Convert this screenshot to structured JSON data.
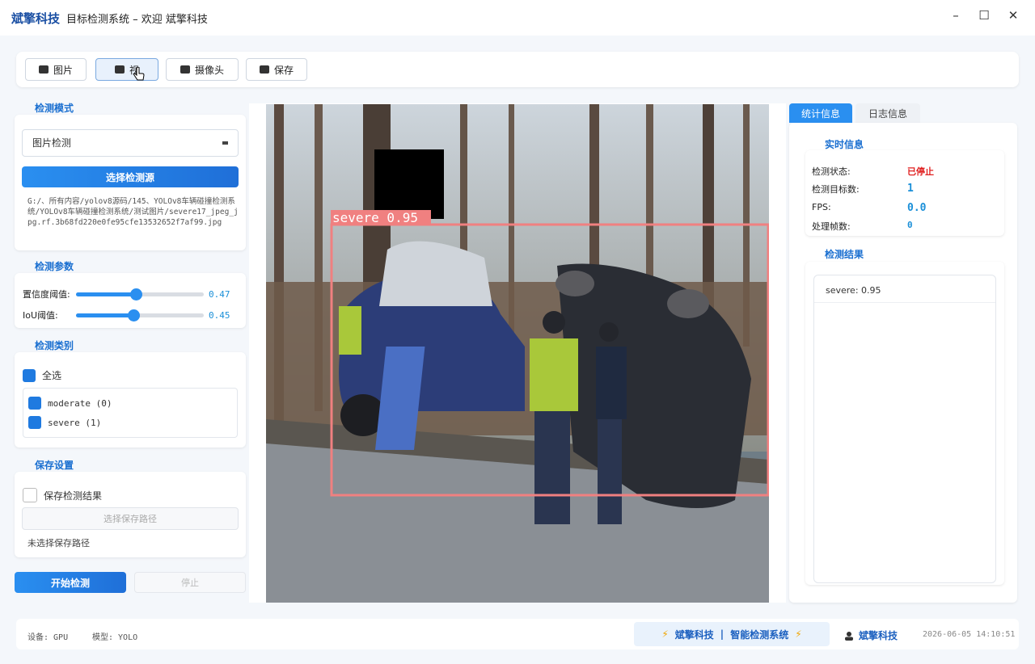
{
  "window": {
    "brand": "斌擎科技",
    "title": "目标检测系统 – 欢迎 斌擎科技",
    "minimize": "–",
    "maximize": "☐",
    "close": "✕"
  },
  "toolbar": {
    "image": "图片",
    "video": "视",
    "camera": "摄像头",
    "save": "保存"
  },
  "mode": {
    "heading": "检测模式",
    "selected": "图片检测",
    "select_source": "选择检测源",
    "path": "G:/、所有内容/yolov8源码/145、YOLOv8车辆碰撞检测系统/YOLOv8车辆碰撞检测系统/测试图片/severe17_jpeg_jpg.rf.3b68fd220e0fe95cfe13532652f7af99.jpg"
  },
  "params": {
    "heading": "检测参数",
    "conf_label": "置信度阈值:",
    "conf_value": "0.47",
    "conf": 0.47,
    "iou_label": "IoU阈值:",
    "iou_value": "0.45",
    "iou": 0.45
  },
  "classes": {
    "heading": "检测类别",
    "all": "全选",
    "items": [
      {
        "label": "moderate (0)"
      },
      {
        "label": "severe (1)"
      }
    ]
  },
  "savecfg": {
    "heading": "保存设置",
    "save_results": "保存检测结果",
    "choose_path": "选择保存路径",
    "no_path": "未选择保存路径"
  },
  "actions": {
    "start": "开始检测",
    "stop": "停止"
  },
  "detection": {
    "box_label": "severe 0.95",
    "box_color": "#f08080"
  },
  "tabs": {
    "stats": "统计信息",
    "logs": "日志信息"
  },
  "realtime": {
    "heading": "实时信息",
    "status_label": "检测状态:",
    "status_value": "已停止",
    "count_label": "检测目标数:",
    "count_value": "1",
    "fps_label": "FPS:",
    "fps_value": "0.0",
    "frames_label": "处理帧数:",
    "frames_value": "0"
  },
  "results": {
    "heading": "检测结果",
    "items": [
      "severe: 0.95"
    ]
  },
  "status": {
    "device": "设备: GPU",
    "model": "模型: YOLO",
    "promo_brand": "斌擎科技",
    "promo_sep": "|",
    "promo_text": "智能检测系统",
    "user": "斌擎科技",
    "time": "2026-06-05 14:10:51"
  },
  "colors": {
    "accent": "#1f7ae0",
    "stopped": "#e02020"
  }
}
